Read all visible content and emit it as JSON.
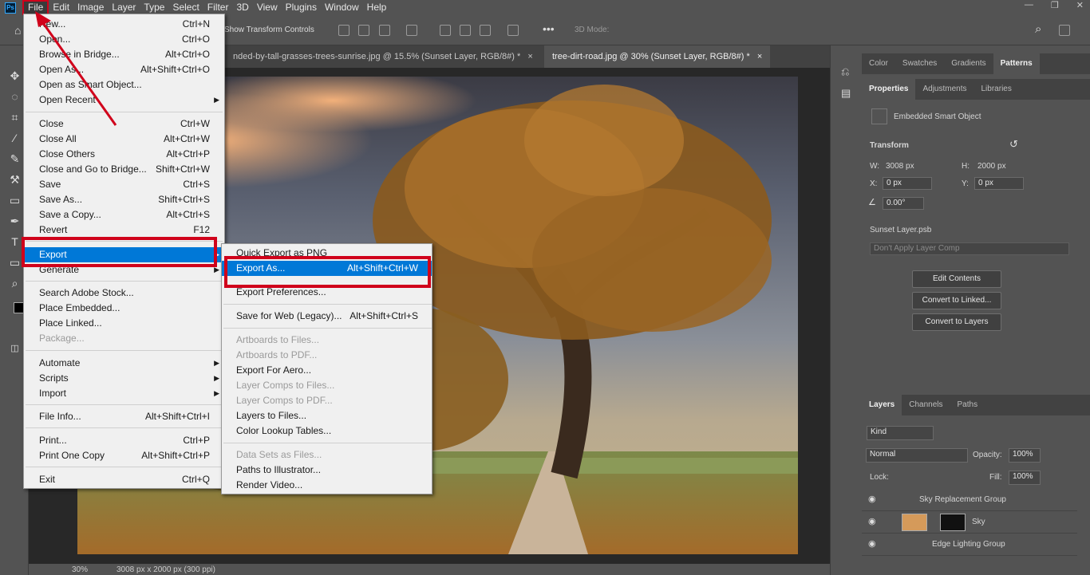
{
  "app": {
    "logo": "Ps"
  },
  "menubar": [
    "File",
    "Edit",
    "Image",
    "Layer",
    "Type",
    "Select",
    "Filter",
    "3D",
    "View",
    "Plugins",
    "Window",
    "Help"
  ],
  "optbar": {
    "show_transform": "Show Transform Controls",
    "mode3d": "3D Mode:"
  },
  "tabs": [
    {
      "label": "nded-by-tall-grasses-trees-sunrise.jpg @ 15.5% (Sunset Layer, RGB/8#) *",
      "close": "×"
    },
    {
      "label": "tree-dirt-road.jpg @ 30% (Sunset Layer, RGB/8#) *",
      "close": "×"
    }
  ],
  "file_menu": [
    {
      "label": "New...",
      "shortcut": "Ctrl+N"
    },
    {
      "label": "Open...",
      "shortcut": "Ctrl+O"
    },
    {
      "label": "Browse in Bridge...",
      "shortcut": "Alt+Ctrl+O"
    },
    {
      "label": "Open As...",
      "shortcut": "Alt+Shift+Ctrl+O"
    },
    {
      "label": "Open as Smart Object...",
      "shortcut": ""
    },
    {
      "label": "Open Recent",
      "shortcut": "",
      "arrow": "▶"
    },
    {
      "label": "Close",
      "shortcut": "Ctrl+W"
    },
    {
      "label": "Close All",
      "shortcut": "Alt+Ctrl+W"
    },
    {
      "label": "Close Others",
      "shortcut": "Alt+Ctrl+P"
    },
    {
      "label": "Close and Go to Bridge...",
      "shortcut": "Shift+Ctrl+W"
    },
    {
      "label": "Save",
      "shortcut": "Ctrl+S"
    },
    {
      "label": "Save As...",
      "shortcut": "Shift+Ctrl+S"
    },
    {
      "label": "Save a Copy...",
      "shortcut": "Alt+Ctrl+S"
    },
    {
      "label": "Revert",
      "shortcut": "F12"
    },
    {
      "label": "Export",
      "shortcut": "",
      "arrow": "▶"
    },
    {
      "label": "Generate",
      "shortcut": "",
      "arrow": "▶"
    },
    {
      "label": "Search Adobe Stock...",
      "shortcut": ""
    },
    {
      "label": "Place Embedded...",
      "shortcut": ""
    },
    {
      "label": "Place Linked...",
      "shortcut": ""
    },
    {
      "label": "Package...",
      "shortcut": ""
    },
    {
      "label": "Automate",
      "shortcut": "",
      "arrow": "▶"
    },
    {
      "label": "Scripts",
      "shortcut": "",
      "arrow": "▶"
    },
    {
      "label": "Import",
      "shortcut": "",
      "arrow": "▶"
    },
    {
      "label": "File Info...",
      "shortcut": "Alt+Shift+Ctrl+I"
    },
    {
      "label": "Print...",
      "shortcut": "Ctrl+P"
    },
    {
      "label": "Print One Copy",
      "shortcut": "Alt+Shift+Ctrl+P"
    },
    {
      "label": "Exit",
      "shortcut": "Ctrl+Q"
    }
  ],
  "export_menu": [
    {
      "label": "Quick Export as PNG",
      "shortcut": ""
    },
    {
      "label": "Export As...",
      "shortcut": "Alt+Shift+Ctrl+W"
    },
    {
      "label": "Export Preferences...",
      "shortcut": ""
    },
    {
      "label": "Save for Web (Legacy)...",
      "shortcut": "Alt+Shift+Ctrl+S"
    },
    {
      "label": "Artboards to Files...",
      "shortcut": ""
    },
    {
      "label": "Artboards to PDF...",
      "shortcut": ""
    },
    {
      "label": "Export For Aero...",
      "shortcut": ""
    },
    {
      "label": "Layer Comps to Files...",
      "shortcut": ""
    },
    {
      "label": "Layer Comps to PDF...",
      "shortcut": ""
    },
    {
      "label": "Layers to Files...",
      "shortcut": ""
    },
    {
      "label": "Color Lookup Tables...",
      "shortcut": ""
    },
    {
      "label": "Data Sets as Files...",
      "shortcut": ""
    },
    {
      "label": "Paths to Illustrator...",
      "shortcut": ""
    },
    {
      "label": "Render Video...",
      "shortcut": ""
    }
  ],
  "panels": {
    "top_tabs": [
      "Color",
      "Swatches",
      "Gradients",
      "Patterns"
    ],
    "prop_tabs": [
      "Properties",
      "Adjustments",
      "Libraries"
    ],
    "smart_object": "Embedded Smart Object",
    "transform": "Transform",
    "w_label": "W:",
    "w_value": "3008 px",
    "h_label": "H:",
    "h_value": "2000 px",
    "x_label": "X:",
    "x_value": "0 px",
    "y_label": "Y:",
    "y_value": "0 px",
    "angle": "0.00°",
    "psb": "Sunset Layer.psb",
    "layer_comp": "Don't Apply Layer Comp",
    "btn_edit": "Edit Contents",
    "btn_linked": "Convert to Linked...",
    "btn_layers": "Convert to Layers",
    "layer_tabs": [
      "Layers",
      "Channels",
      "Paths"
    ],
    "kind": "Kind",
    "blend": "Normal",
    "opacity_label": "Opacity:",
    "opacity": "100%",
    "lock_label": "Lock:",
    "fill_label": "Fill:",
    "fill": "100%",
    "layers": [
      "Sky Replacement Group",
      "Sky",
      "Edge Lighting Group"
    ]
  },
  "status": {
    "zoom": "30%",
    "doc": "3008 px x 2000 px (300 ppi)"
  },
  "colors": {
    "highlight": "#0078d7",
    "annotation": "#d0021b"
  }
}
